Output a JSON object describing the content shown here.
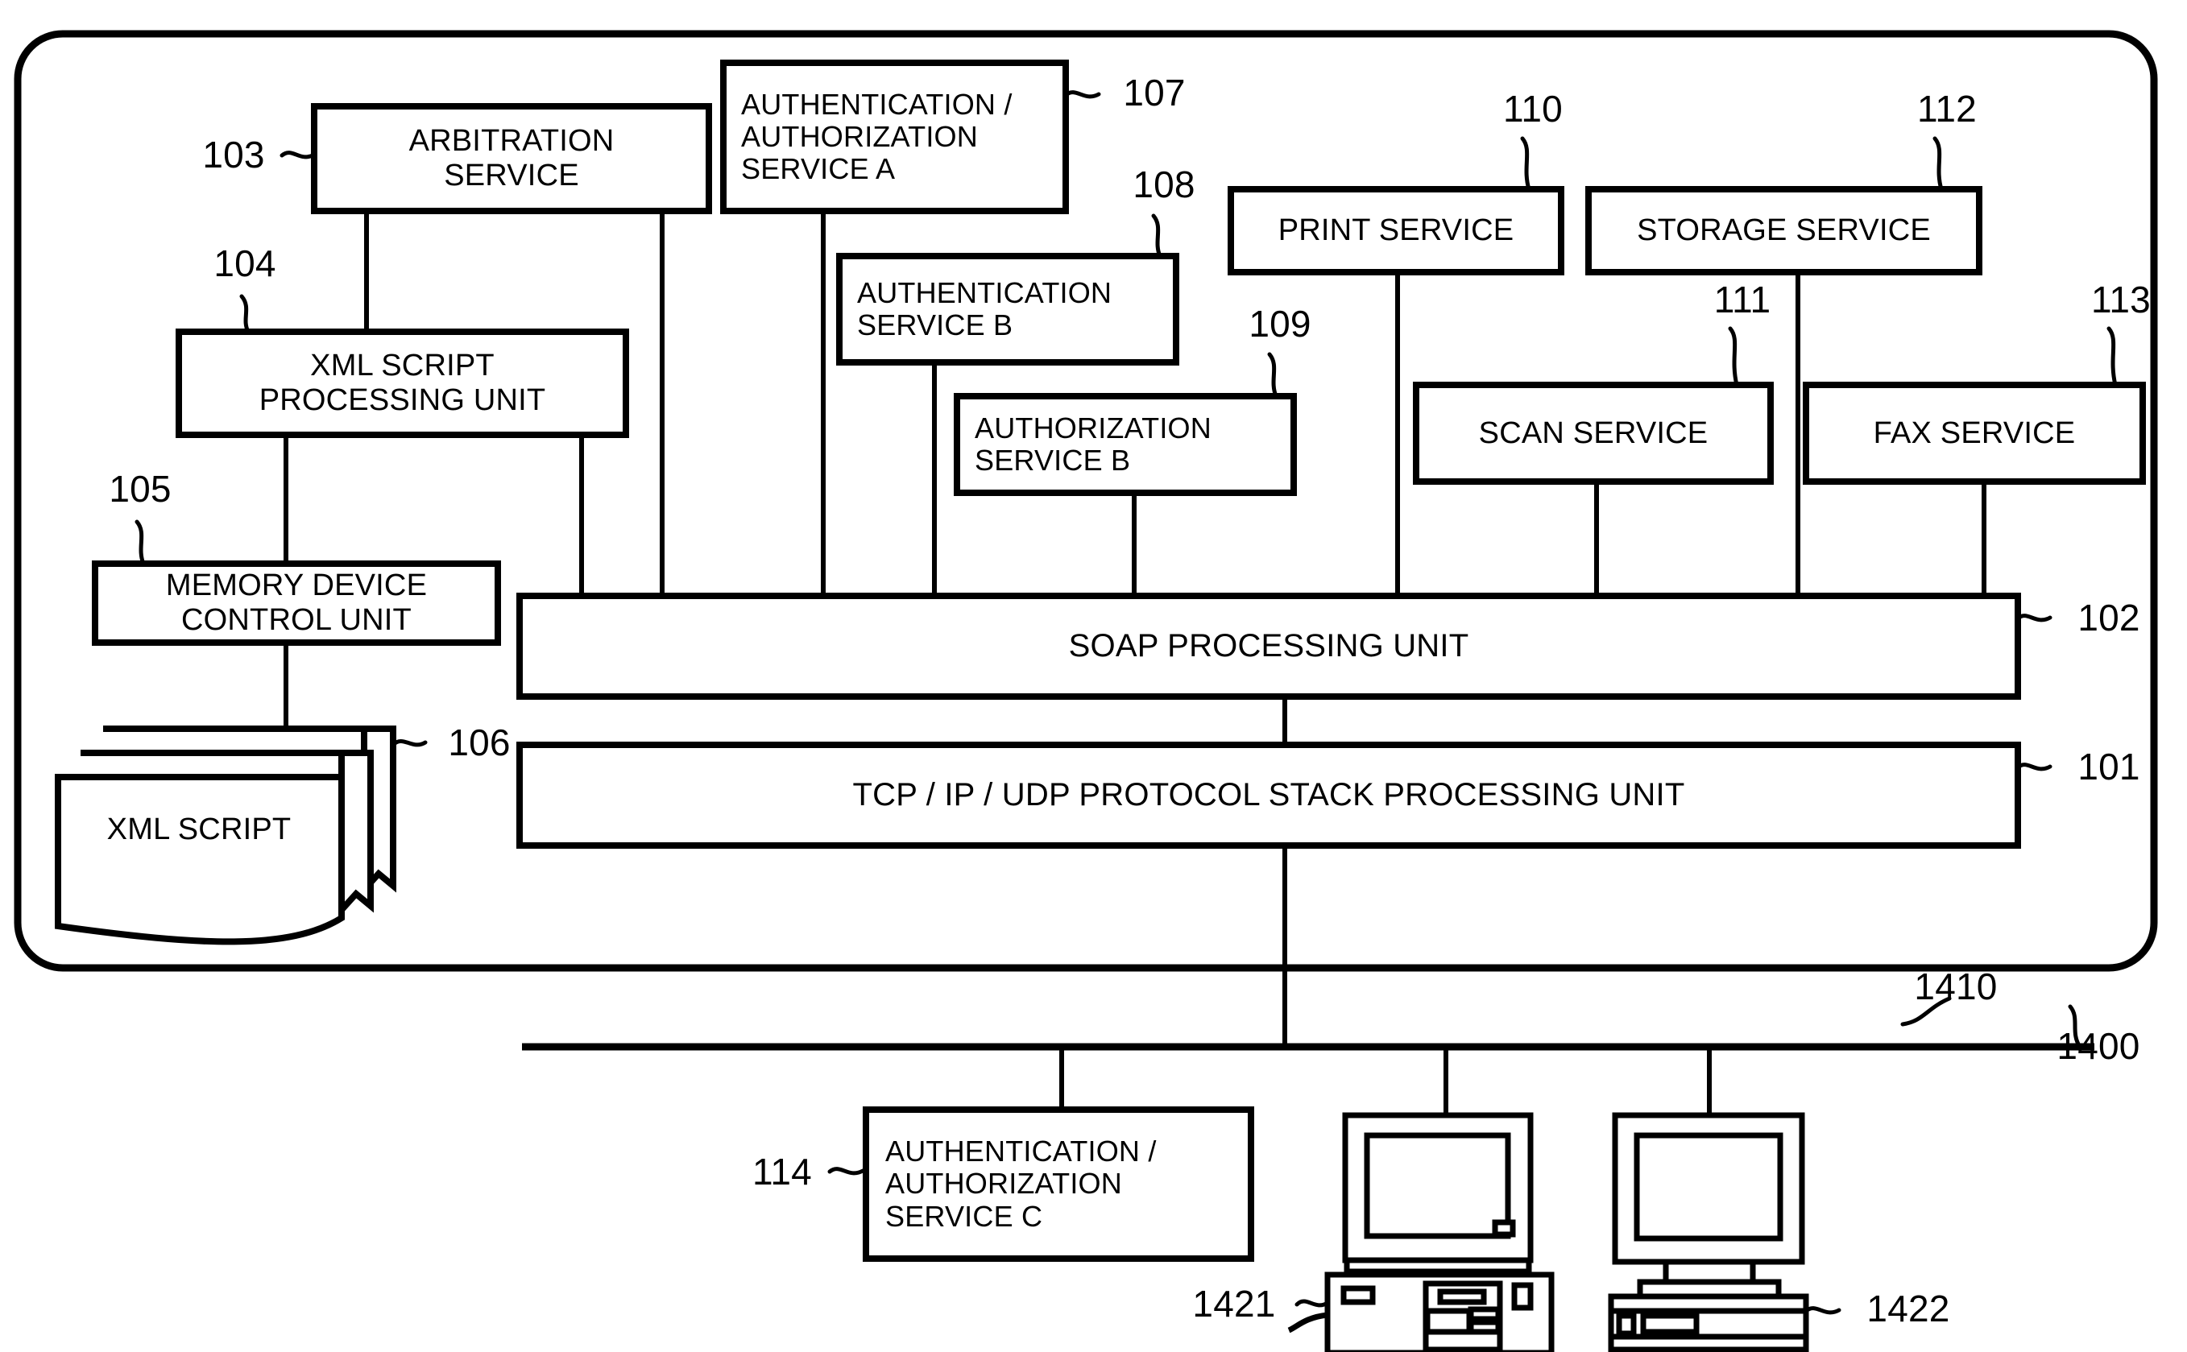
{
  "figure": {
    "type": "patent-block-diagram",
    "device_ref": "1400",
    "network_ref": "1410"
  },
  "boxes": {
    "arbitration_service": {
      "ref": "103",
      "label": "ARBITRATION\nSERVICE"
    },
    "xml_script_processing_unit": {
      "ref": "104",
      "label": "XML SCRIPT\nPROCESSING UNIT"
    },
    "memory_device_control_unit": {
      "ref": "105",
      "label": "MEMORY DEVICE\nCONTROL UNIT"
    },
    "xml_script": {
      "ref": "106",
      "label": "XML SCRIPT"
    },
    "auth_service_a": {
      "ref": "107",
      "label": "AUTHENTICATION /\nAUTHORIZATION\nSERVICE A"
    },
    "authentication_service_b": {
      "ref": "108",
      "label": "AUTHENTICATION\nSERVICE B"
    },
    "authorization_service_b": {
      "ref": "109",
      "label": "AUTHORIZATION\nSERVICE B"
    },
    "print_service": {
      "ref": "110",
      "label": "PRINT SERVICE"
    },
    "scan_service": {
      "ref": "111",
      "label": "SCAN SERVICE"
    },
    "storage_service": {
      "ref": "112",
      "label": "STORAGE SERVICE"
    },
    "fax_service": {
      "ref": "113",
      "label": "FAX SERVICE"
    },
    "soap_processing_unit": {
      "ref": "102",
      "label": "SOAP PROCESSING UNIT"
    },
    "protocol_stack_unit": {
      "ref": "101",
      "label": "TCP / IP / UDP PROTOCOL STACK PROCESSING UNIT"
    },
    "auth_service_c": {
      "ref": "114",
      "label": "AUTHENTICATION /\nAUTHORIZATION\nSERVICE C"
    },
    "computer_1421": {
      "ref": "1421",
      "label": ""
    },
    "computer_1422": {
      "ref": "1422",
      "label": ""
    }
  },
  "refs": {
    "r101": "101",
    "r102": "102",
    "r103": "103",
    "r104": "104",
    "r105": "105",
    "r106": "106",
    "r107": "107",
    "r108": "108",
    "r109": "109",
    "r110": "110",
    "r111": "111",
    "r112": "112",
    "r113": "113",
    "r114": "114",
    "r1400": "1400",
    "r1410": "1410",
    "r1421": "1421",
    "r1422": "1422"
  },
  "colors": {
    "line": "#000000",
    "background": "#ffffff"
  }
}
